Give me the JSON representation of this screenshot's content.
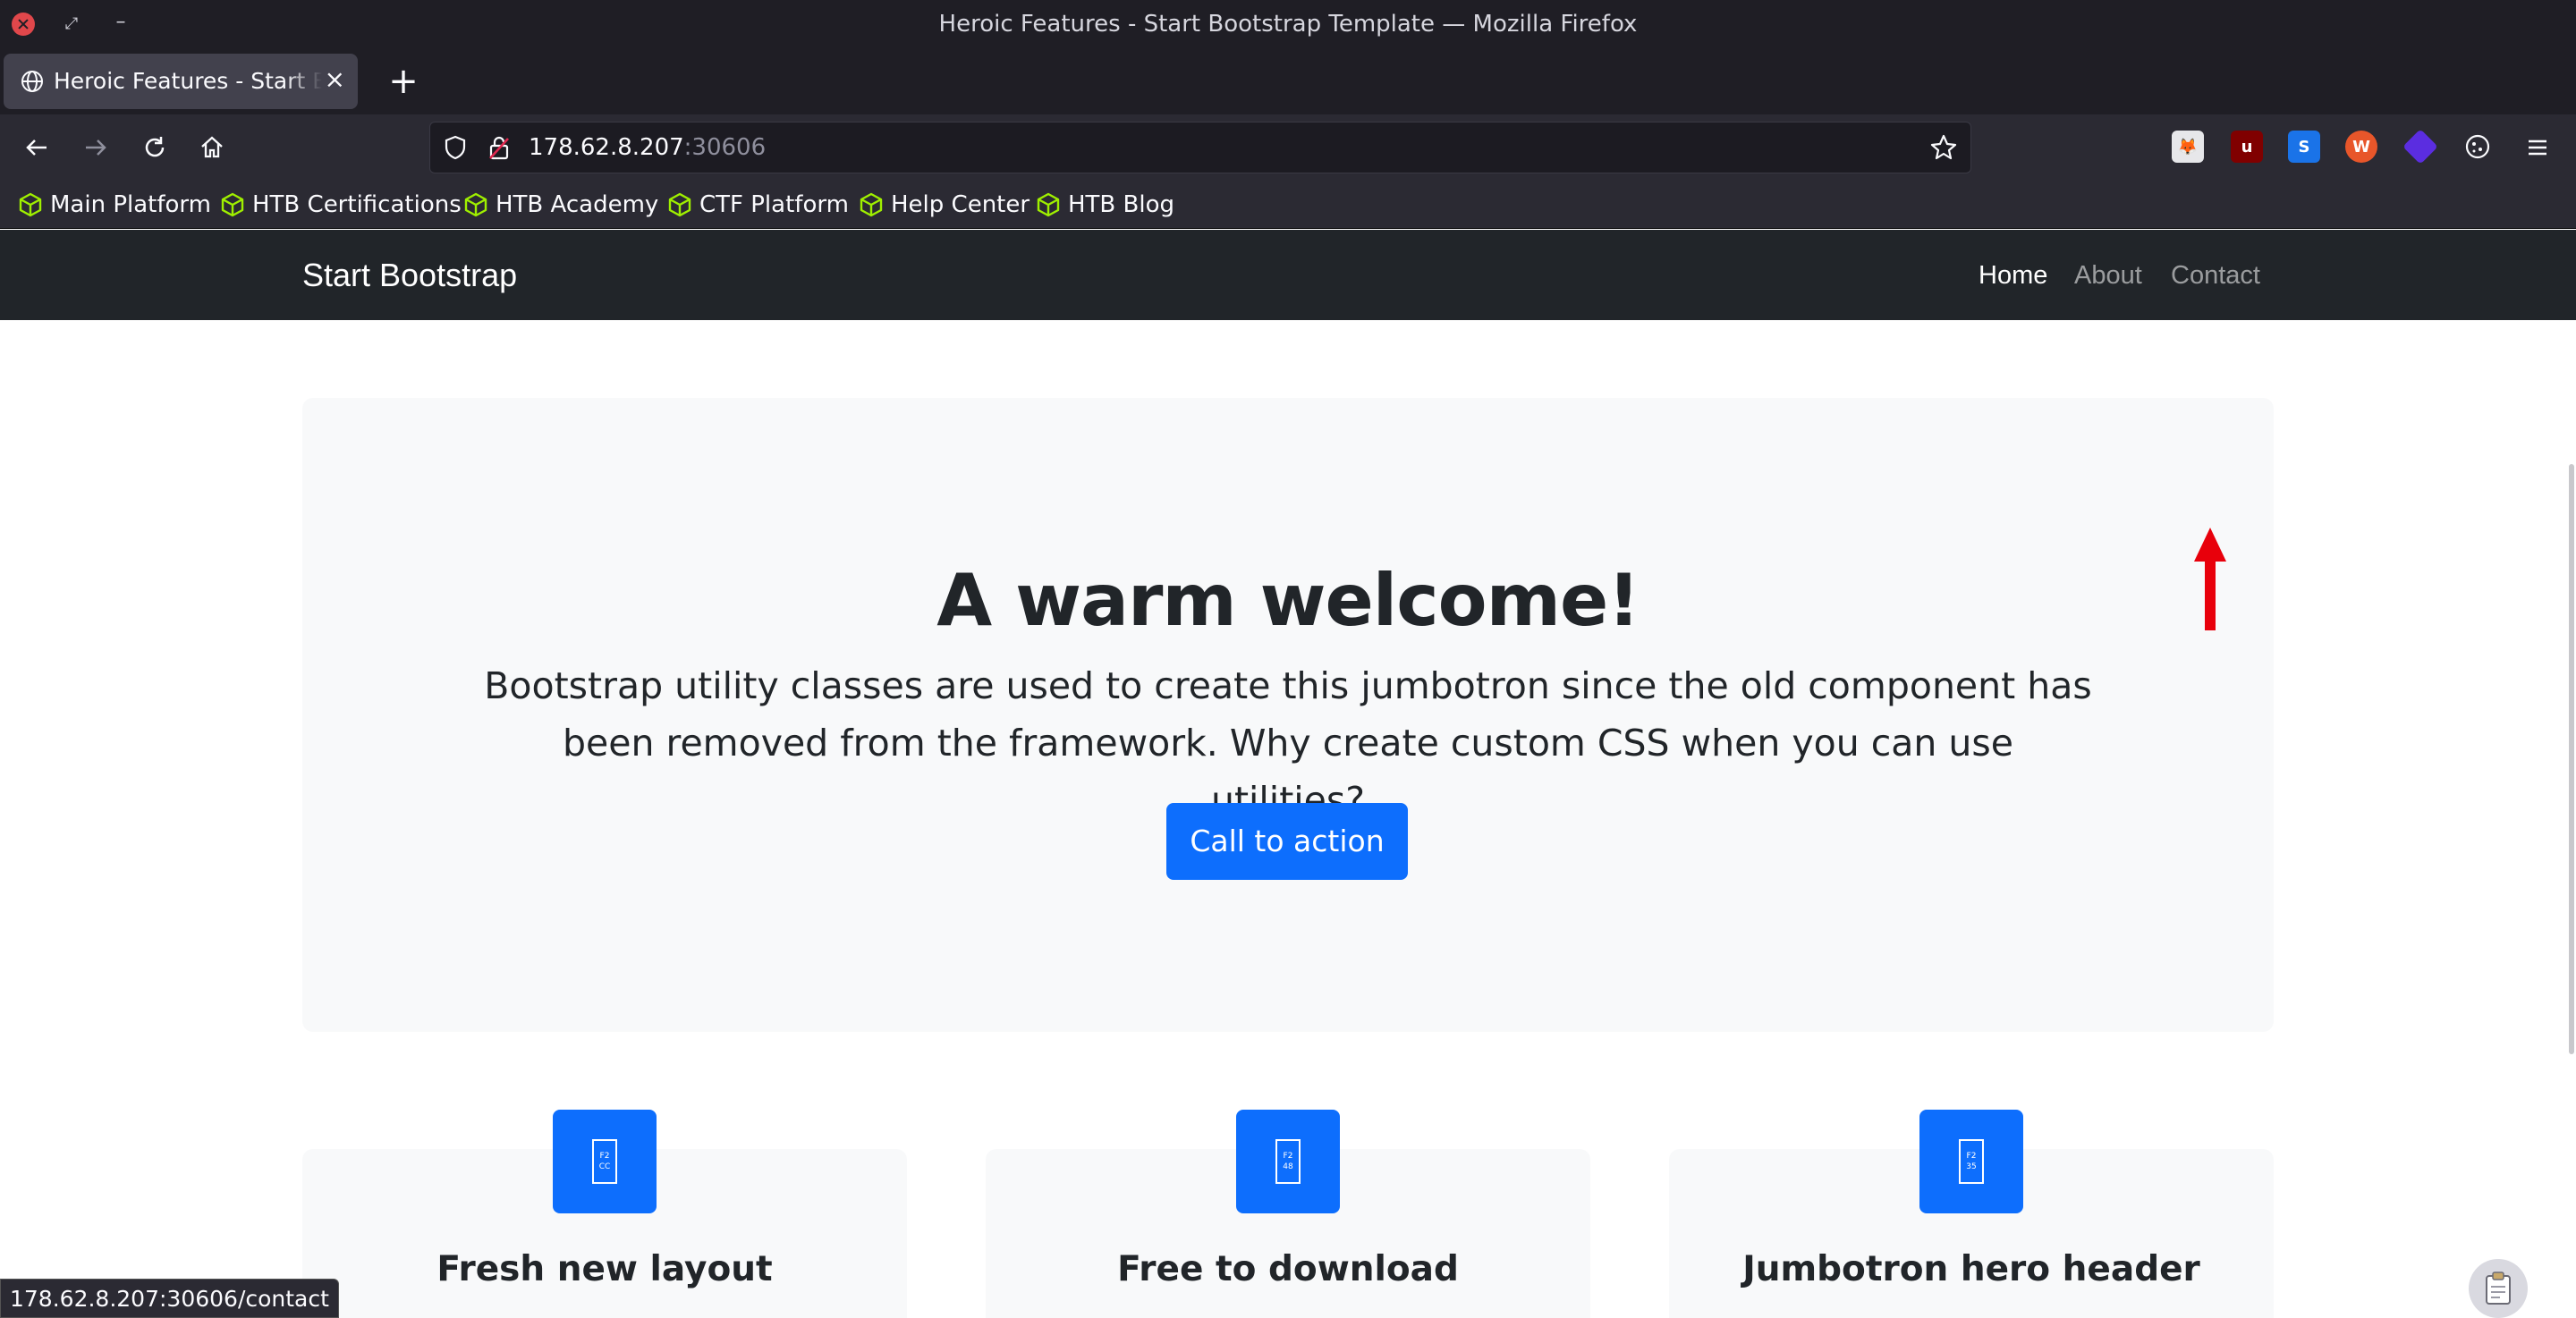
{
  "window": {
    "title": "Heroic Features - Start Bootstrap Template — Mozilla Firefox",
    "restore_glyph": "⤢",
    "minimize_glyph": "–"
  },
  "tab": {
    "label": "Heroic Features - Start Bootstrap Template",
    "close_glyph": "×",
    "new_tab_glyph": "+"
  },
  "toolbar": {
    "url_host": "178.62.8.207",
    "url_port": ":30606",
    "extensions": [
      "foxyproxy-icon",
      "ublock-origin-icon",
      "s-extension-icon",
      "wappalyzer-icon",
      "purple-extension-icon",
      "cookie-editor-icon"
    ]
  },
  "bookmarks": [
    "Main Platform",
    "HTB Certifications",
    "HTB Academy",
    "CTF Platform",
    "Help Center",
    "HTB Blog"
  ],
  "site": {
    "brand": "Start Bootstrap",
    "nav": [
      "Home",
      "About",
      "Contact"
    ],
    "hero": {
      "title": "A warm welcome!",
      "lead": "Bootstrap utility classes are used to create this jumbotron since the old component has been removed from the framework. Why create custom CSS when you can use utilities?",
      "cta": "Call to action"
    },
    "features": [
      {
        "title": "Fresh new layout",
        "glyph": "F2 CC"
      },
      {
        "title": "Free to download",
        "glyph": "F2 48"
      },
      {
        "title": "Jumbotron hero header",
        "glyph": "F2 35"
      }
    ]
  },
  "status": {
    "link_preview": "178.62.8.207:30606/contact"
  },
  "colors": {
    "primary": "#0d6efd",
    "navbar_dark": "#212529",
    "light_bg": "#f8f9fa",
    "annotation_arrow": "#e8000b",
    "htb_green": "#9fef00"
  }
}
